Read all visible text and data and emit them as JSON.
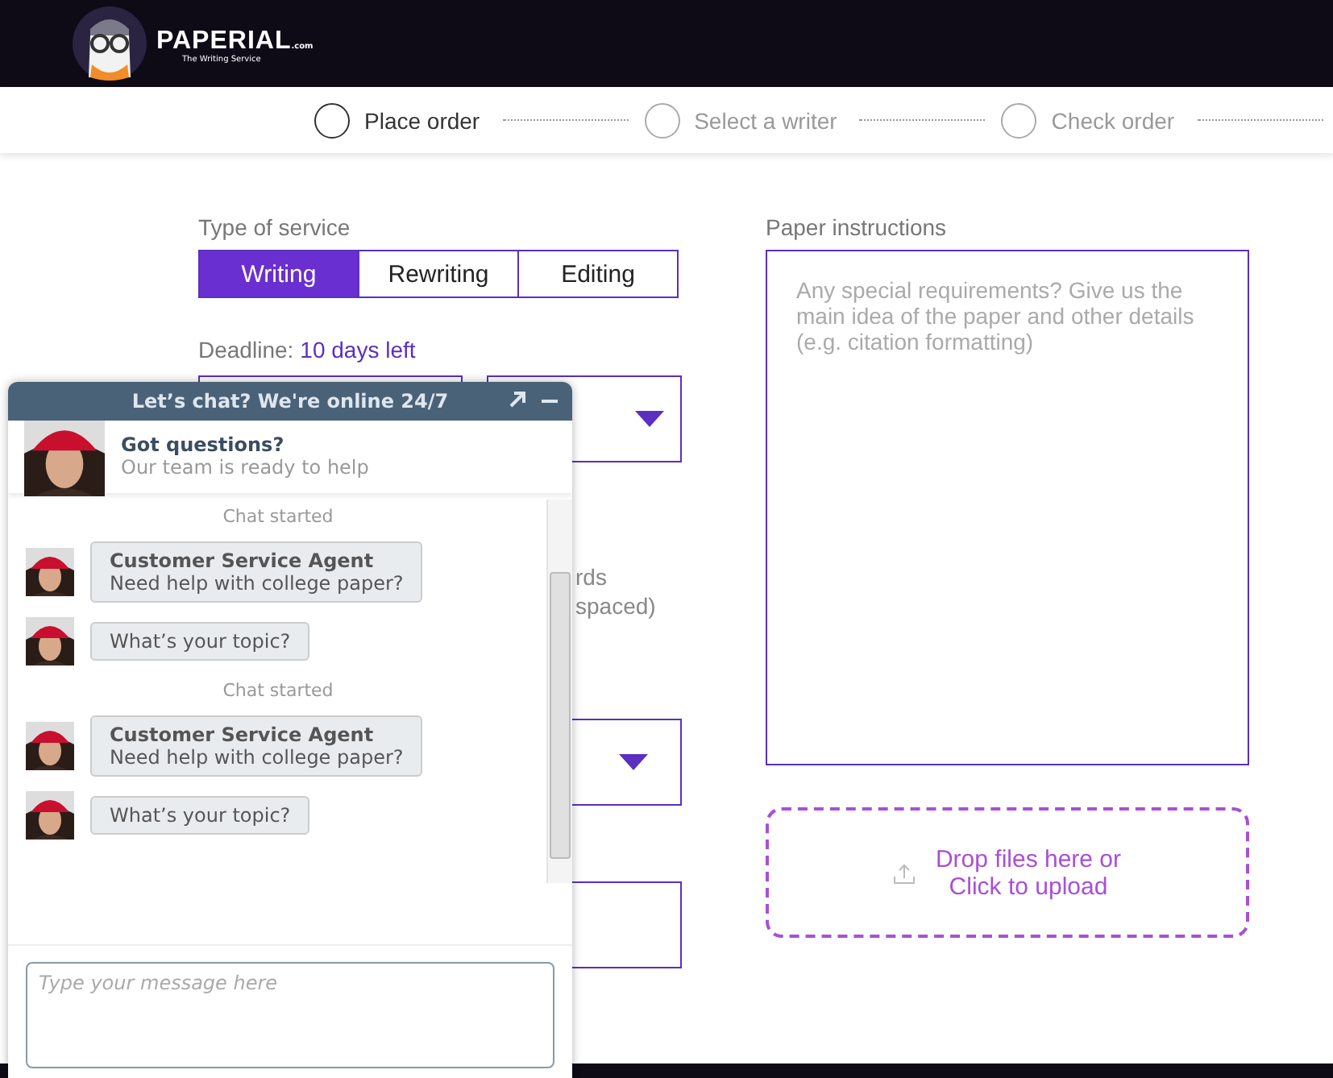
{
  "header": {
    "logo": {
      "name": "PAPERIAL",
      "suffix": ".com",
      "tagline": "The Writing Service"
    }
  },
  "steps": [
    {
      "label": "Place order",
      "selected": true
    },
    {
      "label": "Select a writer",
      "selected": false
    },
    {
      "label": "Check order",
      "selected": false
    }
  ],
  "form": {
    "service_label": "Type of service",
    "services": [
      {
        "label": "Writing",
        "selected": true
      },
      {
        "label": "Rewriting",
        "selected": false
      },
      {
        "label": "Editing",
        "selected": false
      }
    ],
    "deadline_label": "Deadline:",
    "deadline_value": "10 days left",
    "pages_label": [
      "rds",
      "spaced)"
    ],
    "instructions_label": "Paper instructions",
    "instructions": {
      "placeholder": "Any special requirements? Give us the main idea of the paper and other details (e.g. citation formatting)"
    },
    "upload": [
      "Drop files here or",
      "Click to upload"
    ]
  },
  "chat": {
    "title": "Let’s chat? We're online 24/7",
    "intro_title": "Got questions?",
    "intro_text": "Our team is ready to help",
    "messages": [
      {
        "kind": "system",
        "text": "Chat started"
      },
      {
        "kind": "agent",
        "sender": "Customer Service Agent",
        "text": "Need help with college paper?"
      },
      {
        "kind": "agent",
        "text": "What’s your topic?"
      },
      {
        "kind": "system",
        "text": "Chat started"
      },
      {
        "kind": "agent",
        "sender": "Customer Service Agent",
        "text": "Need help with college paper?"
      },
      {
        "kind": "agent",
        "text": "What’s your topic?"
      }
    ],
    "input": {
      "placeholder": "Type your message here"
    }
  }
}
